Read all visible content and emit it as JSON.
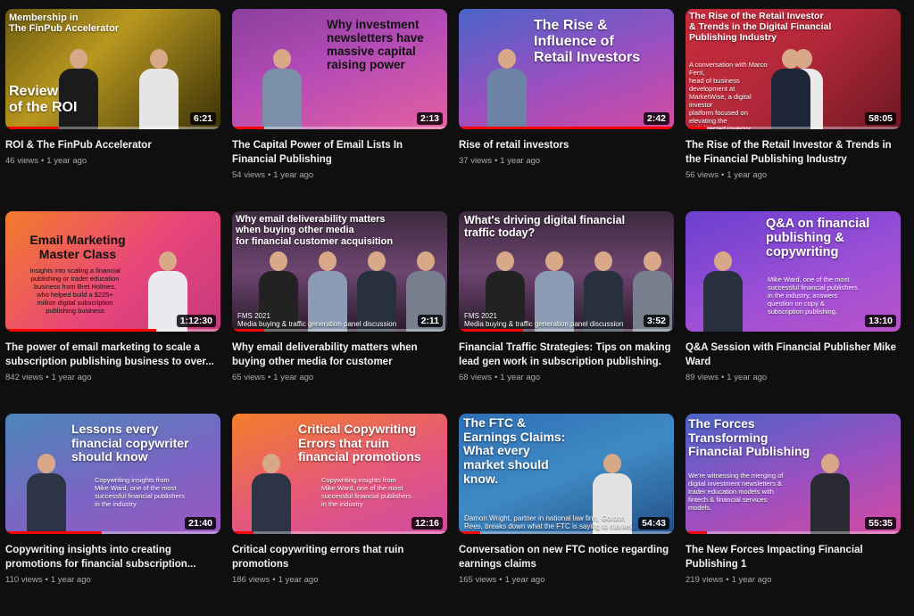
{
  "videos": [
    {
      "thumb_title": "Membership in\nThe FinPub Accelerator",
      "thumb_title2": "Review\nof the ROI",
      "thumb_sub": "",
      "thumb_caption": "",
      "duration": "6:21",
      "progress": 0.25,
      "title": "ROI & The FinPub Accelerator",
      "views": "46 views",
      "age": "1 year ago",
      "theme": "gold"
    },
    {
      "thumb_title": "Why investment\nnewsletters have\nmassive capital\nraising power",
      "thumb_title2": "",
      "thumb_sub": "",
      "thumb_caption": "",
      "duration": "2:13",
      "progress": 0.15,
      "title": "The Capital Power of Email Lists In Financial Publishing",
      "views": "54 views",
      "age": "1 year ago",
      "theme": "purple-dark"
    },
    {
      "thumb_title": "The Rise &\nInfluence of\nRetail Investors",
      "thumb_title2": "",
      "thumb_sub": "",
      "thumb_caption": "",
      "duration": "2:42",
      "progress": 1.0,
      "title": "Rise of retail investors",
      "views": "37 views",
      "age": "1 year ago",
      "theme": "purple"
    },
    {
      "thumb_title": "The Rise of the Retail Investor\n& Trends in the Digital Financial\nPublishing Industry",
      "thumb_title2": "",
      "thumb_sub": "A conversation with Marco Ferri,\nhead of business development at\nMarketWise, a digital investor\nplatform focused on elevating the\nself-directed investor.",
      "thumb_caption": "",
      "duration": "58:05",
      "progress": 0.1,
      "title": "The Rise of the Retail Investor & Trends in the Financial Publishing Industry",
      "views": "56 views",
      "age": "1 year ago",
      "theme": "red"
    },
    {
      "thumb_title": "Email Marketing\nMaster Class",
      "thumb_title2": "",
      "thumb_sub": "Insights into scaling a financial\npublishing or trader education\nbusiness from Bret Holmes,\nwho helped build a $225+\nmillion digital subscription\npublishing business",
      "thumb_caption": "",
      "duration": "1:12:30",
      "progress": 0.7,
      "title": "The power of email marketing to scale a subscription publishing business to over...",
      "views": "842 views",
      "age": "1 year ago",
      "theme": "orange"
    },
    {
      "thumb_title": "Why email deliverability matters\nwhen buying other media\nfor financial customer acquisition",
      "thumb_title2": "",
      "thumb_sub": "",
      "thumb_caption": "FMS 2021\nMedia buying & traffic generation panel discussion",
      "duration": "2:11",
      "progress": 0.15,
      "title": "Why email deliverability matters when buying other media for customer acquisition",
      "views": "65 views",
      "age": "1 year ago",
      "theme": "panel"
    },
    {
      "thumb_title": "What's driving digital financial\ntraffic today?",
      "thumb_title2": "",
      "thumb_sub": "",
      "thumb_caption": "FMS 2021\nMedia buying & traffic generation panel discussion",
      "duration": "3:52",
      "progress": 0.3,
      "title": "Financial Traffic Strategies: Tips on making lead gen work in subscription publishing.",
      "views": "68 views",
      "age": "1 year ago",
      "theme": "panel"
    },
    {
      "thumb_title": "Q&A on financial\npublishing &\ncopywriting",
      "thumb_title2": "",
      "thumb_sub": "Mike Ward, one of the most\nsuccessful financial publishers\nin the industry, answers\nquestion on copy &\nsubscription publishing.",
      "thumb_caption": "",
      "duration": "13:10",
      "progress": 0.0,
      "title": "Q&A Session with Financial Publisher Mike Ward",
      "views": "89 views",
      "age": "1 year ago",
      "theme": "violet"
    },
    {
      "thumb_title": "Lessons every\nfinancial copywriter\nshould know",
      "thumb_title2": "",
      "thumb_sub": "Copywriting insights from\nMike Ward, one of the most\nsuccessful financial publishers\nin the industry",
      "thumb_caption": "",
      "duration": "21:40",
      "progress": 0.45,
      "title": "Copywriting insights into creating promotions for financial subscription...",
      "views": "110 views",
      "age": "1 year ago",
      "theme": "blue-purple"
    },
    {
      "thumb_title": "Critical Copywriting\nErrors that ruin\nfinancial promotions",
      "thumb_title2": "",
      "thumb_sub": "Copywriting insights from\nMike Ward, one of the most\nsuccessful financial publishers\nin the industry",
      "thumb_caption": "",
      "duration": "12:16",
      "progress": 0.1,
      "title": "Critical copywriting errors that ruin promotions",
      "views": "186 views",
      "age": "1 year ago",
      "theme": "pink-orange"
    },
    {
      "thumb_title": "The FTC &\nEarnings Claims:\nWhat every\nmarket should\nknow.",
      "thumb_title2": "",
      "thumb_sub": "",
      "thumb_caption": "Damon Wright, partner in national law firm, Gordon\nRees, breaks down what the FTC is saying to market",
      "duration": "54:43",
      "progress": 0.1,
      "title": "Conversation on new FTC notice regarding earnings claims",
      "views": "165 views",
      "age": "1 year ago",
      "theme": "blue"
    },
    {
      "thumb_title": "The Forces\nTransforming\nFinancial Publishing",
      "thumb_title2": "",
      "thumb_sub": "We're witnessing the merging of\ndigital investment newsletters &\ntrader education models with\nfintech & financial services\nmodels.",
      "thumb_caption": "",
      "duration": "55:35",
      "progress": 0.1,
      "title": "The New Forces Impacting Financial Publishing 1",
      "views": "219 views",
      "age": "1 year ago",
      "theme": "purple"
    }
  ]
}
